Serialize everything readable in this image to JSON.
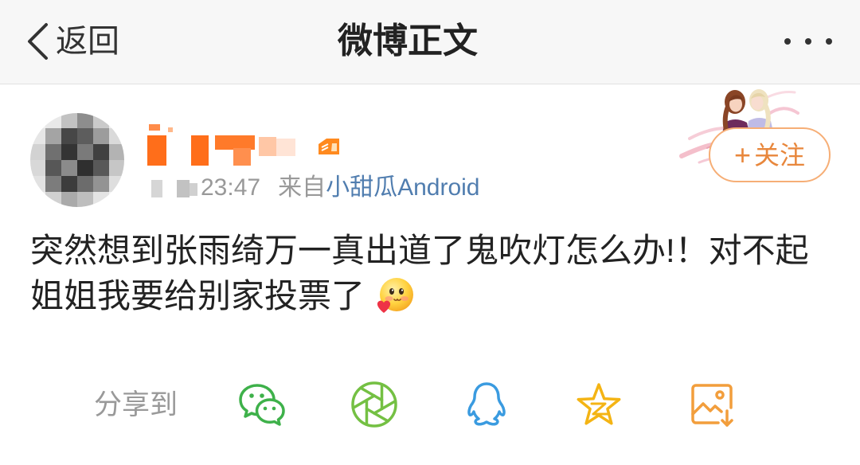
{
  "header": {
    "back_icon": "chevron-left-icon",
    "back_label": "返回",
    "title": "微博正文",
    "more_icon": "more-dots-icon"
  },
  "post": {
    "badge_icon": "member-badge-icon",
    "time": "23:47",
    "source_prefix": "来自",
    "source": "小甜瓜Android",
    "text": "突然想到张雨绮万一真出道了鬼吹灯怎么办!！对不起姐姐我要给别家投票了",
    "emoji_icon": "shy-love-emoji-icon"
  },
  "follow_button": {
    "plus": "+",
    "label": "关注"
  },
  "share": {
    "label": "分享到",
    "targets": [
      {
        "icon": "wechat-icon"
      },
      {
        "icon": "wechat-moments-icon"
      },
      {
        "icon": "qq-icon"
      },
      {
        "icon": "qzone-icon"
      },
      {
        "icon": "save-image-icon"
      }
    ]
  },
  "colors": {
    "text": "#222222",
    "meta_gray": "#999999",
    "link_blue": "#507daf",
    "accent_orange": "#e8873c",
    "follow_border": "#f6ae76",
    "wechat_green": "#3eb14a",
    "moments_green": "#74c043",
    "qq_blue": "#3a9be0",
    "qzone_yellow": "#f4b414",
    "save_orange": "#f29e3c"
  }
}
